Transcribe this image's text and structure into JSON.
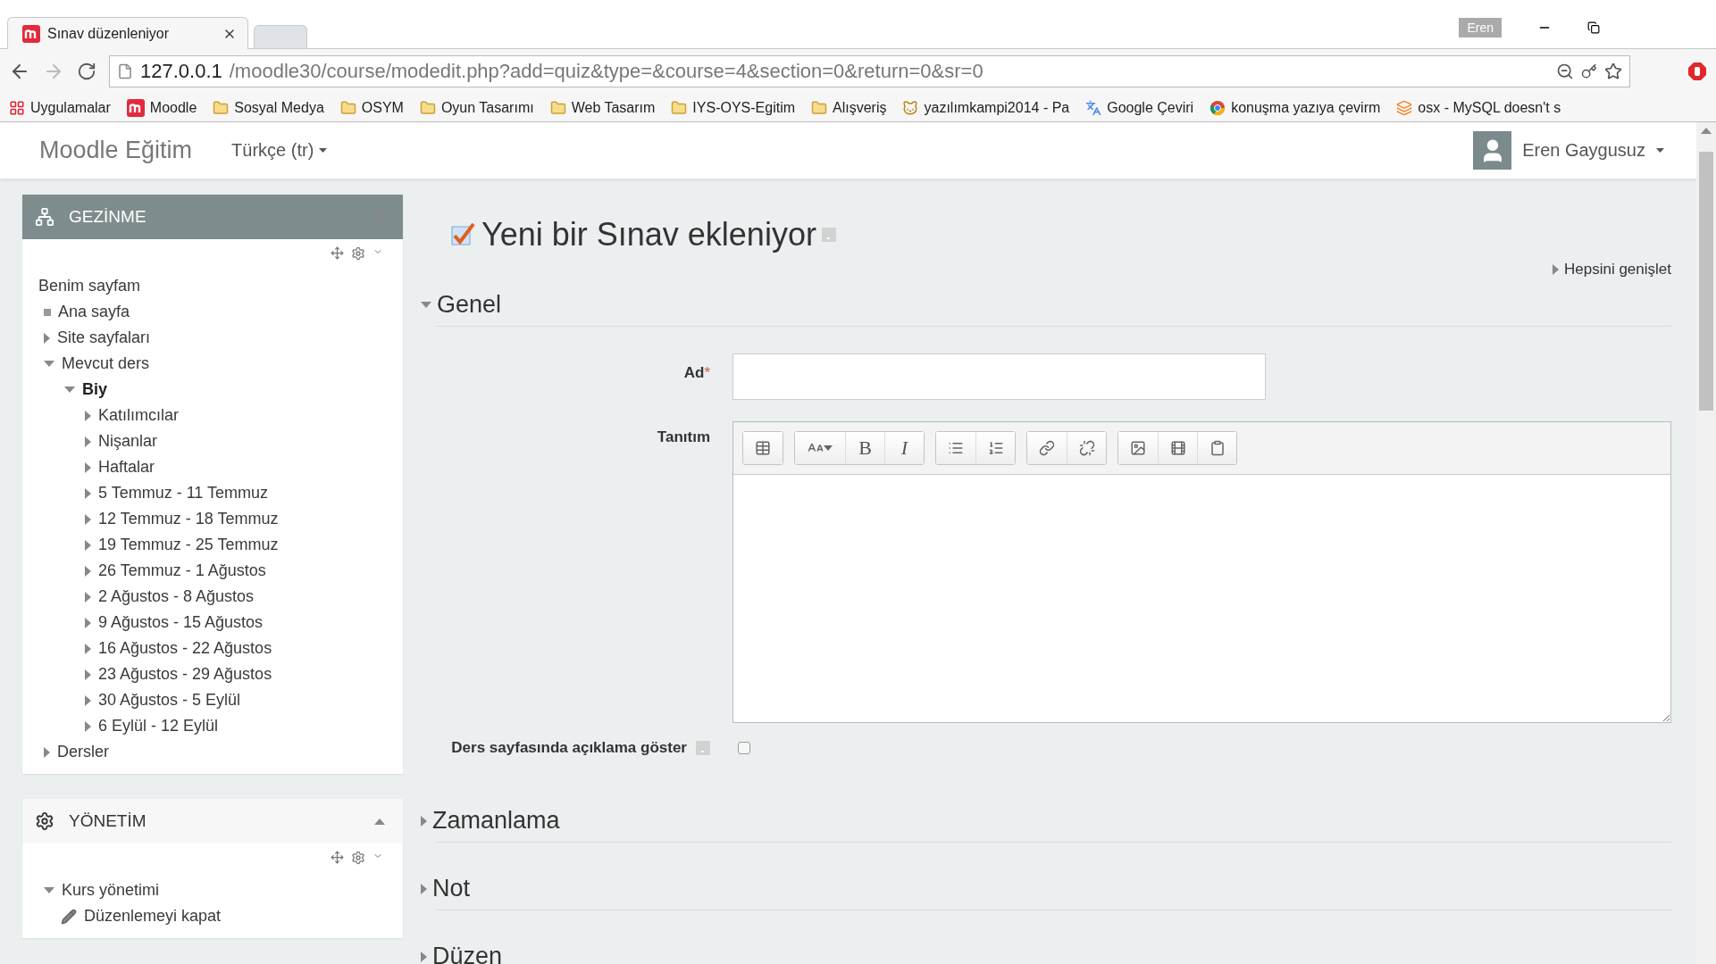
{
  "browser": {
    "tabs": [
      {
        "title": "Sınav düzenleniyor",
        "selected": true
      },
      {
        "selected": false
      }
    ],
    "profile": "Eren",
    "url": {
      "host": "127.0.0.1",
      "path": "/moodle30/course/modedit.php?add=quiz&type=&course=4&section=0&return=0&sr=0"
    },
    "bookmarks": [
      {
        "kind": "apps",
        "label": "Uygulamalar"
      },
      {
        "kind": "moodle",
        "label": "Moodle"
      },
      {
        "kind": "folder",
        "label": "Sosyal Medya"
      },
      {
        "kind": "folder",
        "label": "OSYM"
      },
      {
        "kind": "folder",
        "label": "Oyun Tasarımı"
      },
      {
        "kind": "folder",
        "label": "Web Tasarım"
      },
      {
        "kind": "folder",
        "label": "IYS-OYS-Egitim"
      },
      {
        "kind": "folder",
        "label": "Alışveriş"
      },
      {
        "kind": "cat",
        "label": "yazılımkampi2014 - Pa"
      },
      {
        "kind": "translate",
        "label": "Google Çeviri"
      },
      {
        "kind": "browser",
        "label": "konuşma yazıya çevirm"
      },
      {
        "kind": "stack",
        "label": "osx - MySQL doesn't s"
      }
    ]
  },
  "navbar": {
    "site_name": "Moodle Eğitim",
    "language": "Türkçe (tr)",
    "user": "Eren Gaygusuz"
  },
  "blocks": [
    {
      "kind": "navigation",
      "title": "GEZİNME",
      "highlighted": true,
      "items": [
        {
          "kind": "heading",
          "label": "Benim sayfam"
        },
        {
          "kind": "leaf",
          "label": "Ana sayfa"
        },
        {
          "kind": "branch",
          "label": "Site sayfaları",
          "expanded": false
        },
        {
          "kind": "branch",
          "label": "Mevcut ders",
          "expanded": true,
          "children": [
            {
              "kind": "course",
              "label": "Biy",
              "expanded": true,
              "children": [
                {
                  "kind": "branch",
                  "label": "Katılımcılar",
                  "expanded": false
                },
                {
                  "kind": "branch",
                  "label": "Nişanlar",
                  "expanded": false
                },
                {
                  "kind": "branch",
                  "label": "Haftalar",
                  "expanded": false
                },
                {
                  "kind": "branch",
                  "label": "5 Temmuz - 11 Temmuz",
                  "expanded": false
                },
                {
                  "kind": "branch",
                  "label": "12 Temmuz - 18 Temmuz",
                  "expanded": false
                },
                {
                  "kind": "branch",
                  "label": "19 Temmuz - 25 Temmuz",
                  "expanded": false
                },
                {
                  "kind": "branch",
                  "label": "26 Temmuz - 1 Ağustos",
                  "expanded": false
                },
                {
                  "kind": "branch",
                  "label": "2 Ağustos - 8 Ağustos",
                  "expanded": false
                },
                {
                  "kind": "branch",
                  "label": "9 Ağustos - 15 Ağustos",
                  "expanded": false
                },
                {
                  "kind": "branch",
                  "label": "16 Ağustos - 22 Ağustos",
                  "expanded": false
                },
                {
                  "kind": "branch",
                  "label": "23 Ağustos - 29 Ağustos",
                  "expanded": false
                },
                {
                  "kind": "branch",
                  "label": "30 Ağustos - 5 Eylül",
                  "expanded": false
                },
                {
                  "kind": "branch",
                  "label": "6 Eylül - 12 Eylül",
                  "expanded": false
                }
              ]
            }
          ]
        },
        {
          "kind": "branch",
          "label": "Dersler",
          "expanded": false
        }
      ]
    },
    {
      "kind": "admin",
      "title": "YÖNETİM",
      "highlighted": false,
      "items": [
        {
          "kind": "branch",
          "label": "Kurs yönetimi",
          "expanded": true,
          "children": [
            {
              "kind": "action",
              "label": "Düzenlemeyi kapat"
            }
          ]
        }
      ]
    }
  ],
  "main": {
    "title": "Yeni bir Sınav ekleniyor",
    "expand_all": "Hepsini genişlet",
    "sections": [
      {
        "title": "Genel",
        "expanded": true,
        "fields": [
          {
            "kind": "text",
            "label": "Ad",
            "required_mark": "*"
          },
          {
            "kind": "editor",
            "label": "Tanıtım",
            "toolbar": [
              {
                "buttons": [
                  {
                    "kind": "table"
                  }
                ]
              },
              {
                "buttons": [
                  {
                    "kind": "fontsize"
                  },
                  {
                    "kind": "bold",
                    "label": "B"
                  },
                  {
                    "kind": "italic",
                    "label": "I"
                  }
                ]
              },
              {
                "buttons": [
                  {
                    "kind": "bullets"
                  },
                  {
                    "kind": "numbers"
                  }
                ]
              },
              {
                "buttons": [
                  {
                    "kind": "link"
                  },
                  {
                    "kind": "unlink"
                  }
                ]
              },
              {
                "buttons": [
                  {
                    "kind": "image"
                  },
                  {
                    "kind": "media"
                  },
                  {
                    "kind": "paste"
                  }
                ]
              }
            ]
          },
          {
            "kind": "checkbox",
            "label": "Ders sayfasında açıklama göster",
            "checked": false
          }
        ]
      },
      {
        "title": "Zamanlama",
        "expanded": false
      },
      {
        "title": "Not",
        "expanded": false
      },
      {
        "title": "Düzen",
        "expanded": false
      }
    ]
  }
}
